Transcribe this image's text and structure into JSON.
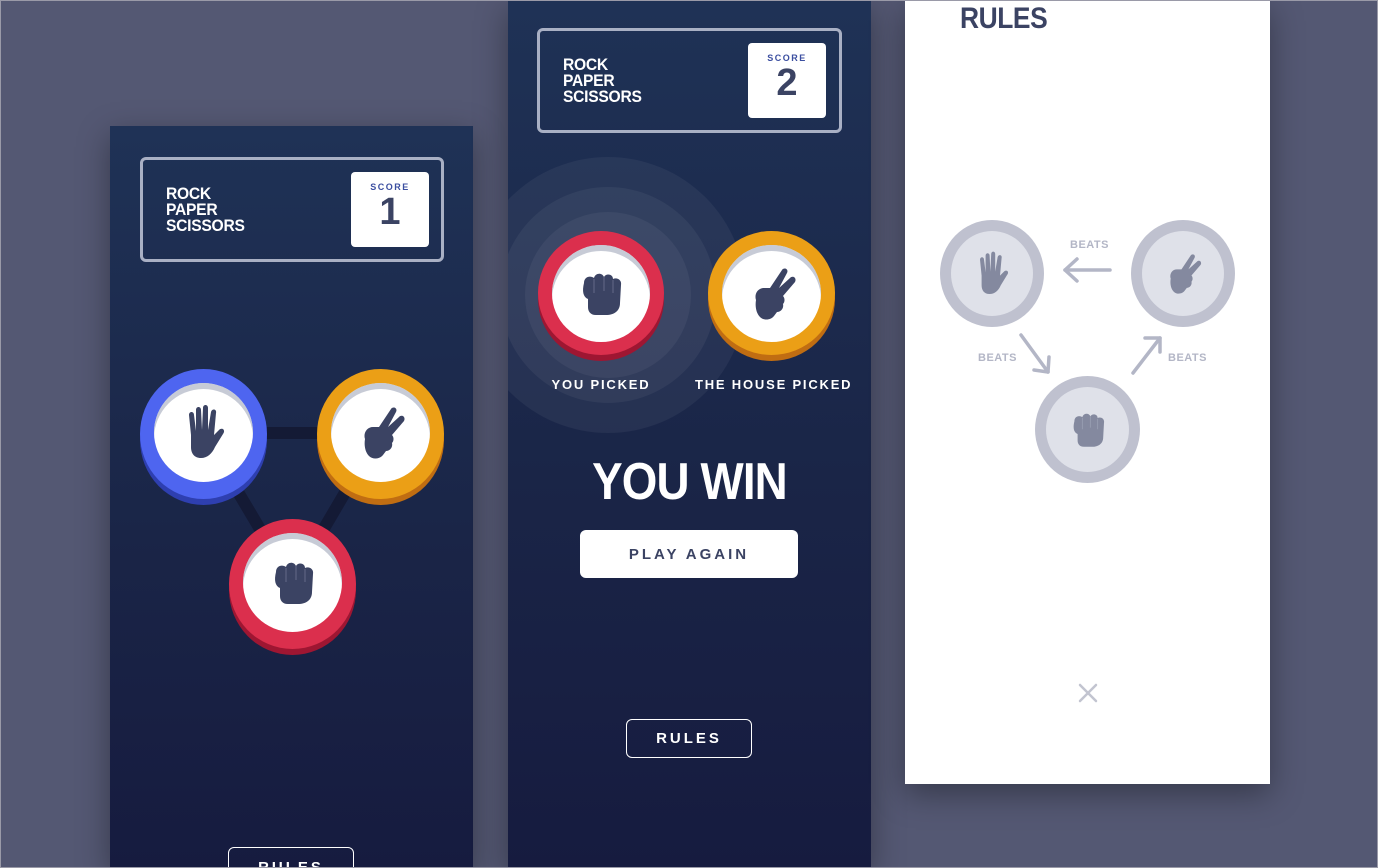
{
  "colors": {
    "background": "#545873",
    "paper": "#4e65f0",
    "scissors": "#eb9f16",
    "rock": "#db2f4d",
    "text_dark": "#3b4363",
    "score_label": "#3b4ea0"
  },
  "game": {
    "title": "ROCK\nPAPER\nSCISSORS",
    "score_label": "SCORE",
    "score_value": "1",
    "choices": [
      "paper-icon",
      "scissors-icon",
      "rock-icon"
    ],
    "rules_label": "RULES"
  },
  "result_screen": {
    "title": "ROCK\nPAPER\nSCISSORS",
    "score_label": "SCORE",
    "score_value": "2",
    "player_pick": "rock-icon",
    "house_pick": "scissors-icon",
    "you_picked_label": "YOU PICKED",
    "house_picked_label": "THE HOUSE PICKED",
    "result": "YOU WIN",
    "play_again_label": "PLAY AGAIN",
    "rules_label": "RULES"
  },
  "rules_modal": {
    "title": "RULES",
    "beats_label": "BEATS",
    "close_icon": "close-icon"
  }
}
